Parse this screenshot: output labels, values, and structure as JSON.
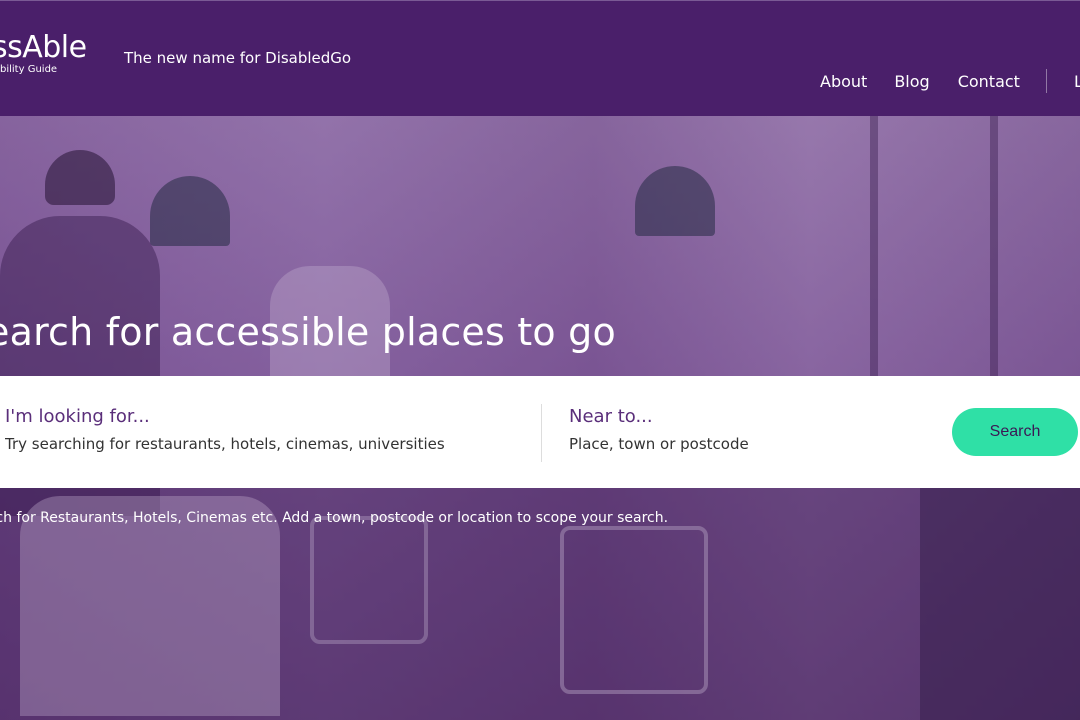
{
  "header": {
    "logo_name": "essAble",
    "logo_sub": "bility Guide",
    "tagline": "The new name for DisabledGo",
    "nav": {
      "about": "About",
      "blog": "Blog",
      "contact": "Contact",
      "login": "L"
    }
  },
  "hero": {
    "title": "earch for accessible places to go",
    "looking_label": "I'm looking for...",
    "looking_placeholder": "Try searching for restaurants, hotels, cinemas, universities",
    "near_label": "Near to...",
    "near_placeholder": "Place, town or postcode",
    "search_button": "Search",
    "hint": "rch for Restaurants, Hotels, Cinemas etc. Add a town, postcode or location to scope your search."
  },
  "colors": {
    "header_bg": "#4a1f6a",
    "accent": "#2fe0a6",
    "label": "#5a2e7a"
  }
}
